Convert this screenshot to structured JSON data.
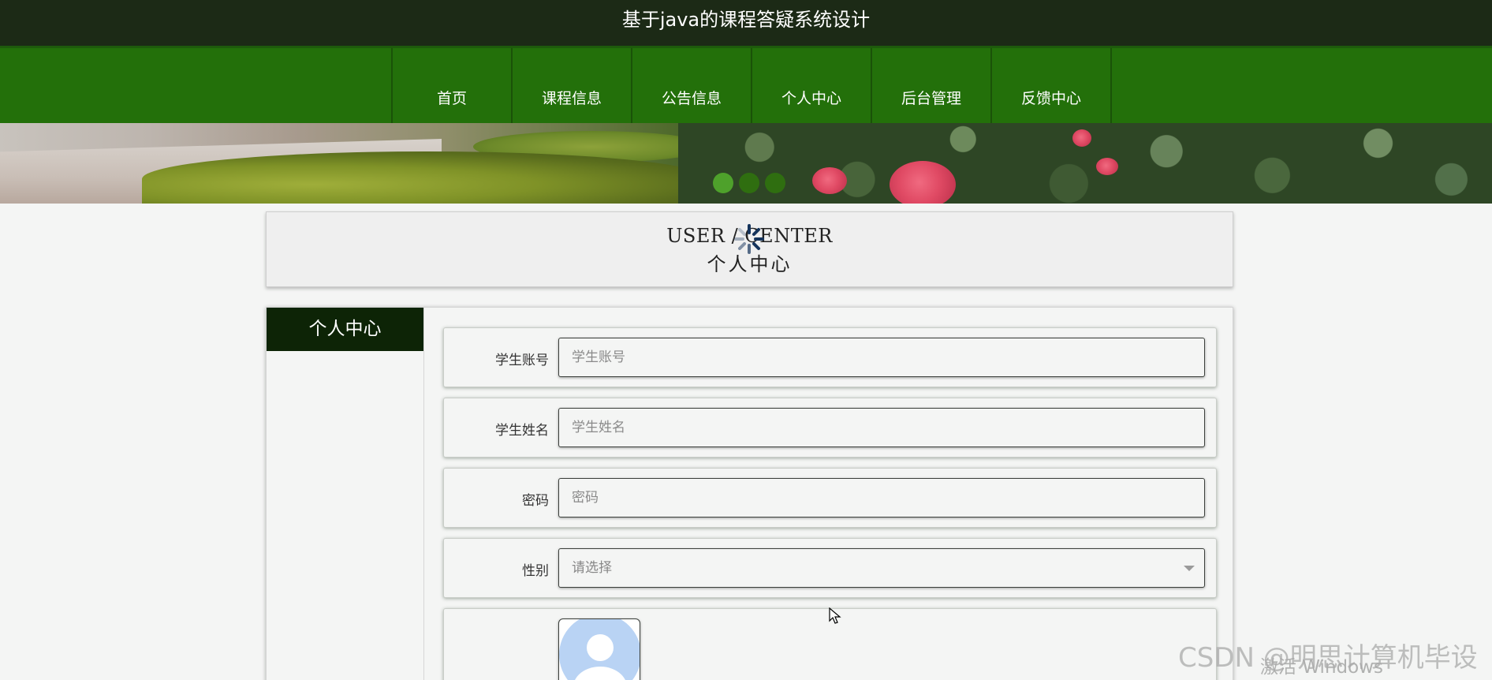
{
  "app": {
    "title": "基于java的课程答疑系统设计"
  },
  "nav": {
    "items": [
      {
        "label": "首页"
      },
      {
        "label": "课程信息"
      },
      {
        "label": "公告信息"
      },
      {
        "label": "个人中心"
      },
      {
        "label": "后台管理"
      },
      {
        "label": "反馈中心"
      }
    ]
  },
  "banner": {
    "dots": [
      {
        "active": true
      },
      {
        "active": false
      },
      {
        "active": false
      }
    ]
  },
  "header": {
    "en": "USER / CENTER",
    "cn": "个人中心"
  },
  "sidebar": {
    "title": "个人中心"
  },
  "form": {
    "account": {
      "label": "学生账号",
      "placeholder": "学生账号",
      "value": ""
    },
    "name": {
      "label": "学生姓名",
      "placeholder": "学生姓名",
      "value": ""
    },
    "password": {
      "label": "密码",
      "placeholder": "密码",
      "value": ""
    },
    "gender": {
      "label": "性别",
      "selected": "请选择"
    },
    "avatar": {
      "icon": "user-avatar-icon"
    }
  },
  "watermark": {
    "csdn": "CSDN @明思计算机毕设",
    "windows": "激活 Windows"
  },
  "colors": {
    "title_bar": "#1c2a16",
    "nav_bar": "#23700a",
    "side_title": "#0d2406",
    "dot_active": "#4ea12b",
    "dot": "#2f6e10"
  }
}
